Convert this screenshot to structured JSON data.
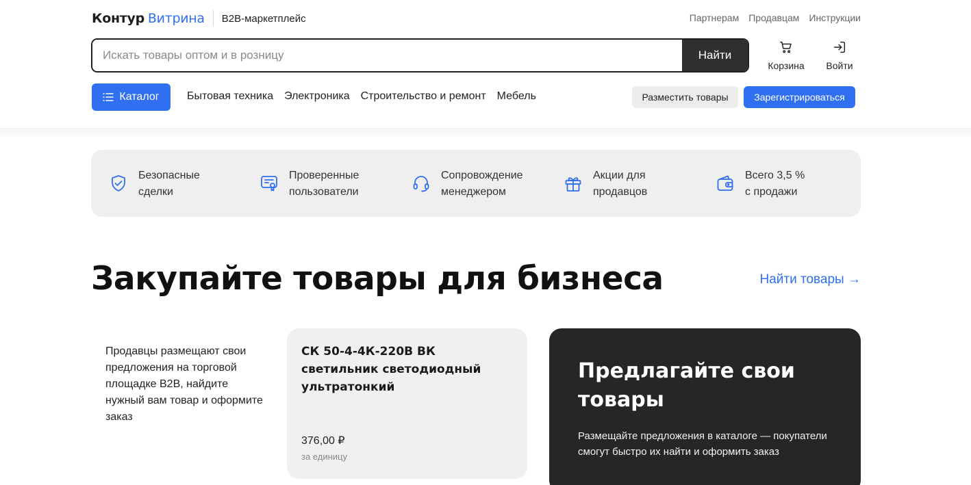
{
  "header": {
    "logo": {
      "kontur": "Контур",
      "vitrina": "Витрина",
      "tagline": "B2B-маркетплейс"
    },
    "top_links": [
      "Партнерам",
      "Продавцам",
      "Инструкции"
    ],
    "search": {
      "placeholder": "Искать товары оптом и в розницу",
      "value": "",
      "button": "Найти"
    },
    "actions": {
      "cart": "Корзина",
      "login": "Войти"
    },
    "catalog_button": "Каталог",
    "nav": [
      "Бытовая техника",
      "Электроника",
      "Строительство и ремонт",
      "Мебель"
    ],
    "place_goods": "Разместить товары",
    "register": "Зарегистрироваться"
  },
  "features": [
    {
      "icon": "shield-check-icon",
      "line1": "Безопасные",
      "line2": "сделки"
    },
    {
      "icon": "certificate-icon",
      "line1": "Проверенные",
      "line2": "пользователи"
    },
    {
      "icon": "headset-icon",
      "line1": "Сопровождение",
      "line2": "менеджером"
    },
    {
      "icon": "gift-icon",
      "line1": "Акции для",
      "line2": "продавцов"
    },
    {
      "icon": "wallet-icon",
      "line1": "Всего 3,5 %",
      "line2": "с продажи"
    }
  ],
  "hero": {
    "title": "Закупайте товары для бизнеса",
    "link": "Найти товары →",
    "intro": "Продавцы размещают свои предложения на торговой площадке B2B, найдите нужный вам товар и оформите заказ"
  },
  "product": {
    "name": "СК 50-4-4К-220В ВК светильник светодиодный ультратонкий",
    "price": "376,00 ₽",
    "unit": "за единицу"
  },
  "offer": {
    "title": "Предлагайте свои товары",
    "text": "Размещайте предложения в каталоге — покупатели смогут быстро их найти и оформить заказ"
  },
  "colors": {
    "accent": "#2f6ff0",
    "dark": "#262626",
    "panel": "#efefef"
  }
}
